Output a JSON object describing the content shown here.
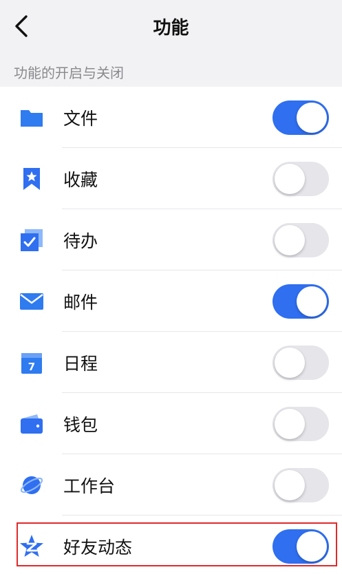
{
  "header": {
    "title": "功能"
  },
  "section": {
    "title": "功能的开启与关闭"
  },
  "colors": {
    "accent": "#2f6ff0",
    "toggle_off": "#e5e5ea",
    "highlight": "#e0292b"
  },
  "features": [
    {
      "label": "文件",
      "icon": "folder-icon",
      "enabled": true
    },
    {
      "label": "收藏",
      "icon": "bookmark-star-icon",
      "enabled": false
    },
    {
      "label": "待办",
      "icon": "checkbox-todo-icon",
      "enabled": false
    },
    {
      "label": "邮件",
      "icon": "mail-icon",
      "enabled": true
    },
    {
      "label": "日程",
      "icon": "calendar-icon",
      "enabled": false
    },
    {
      "label": "钱包",
      "icon": "wallet-icon",
      "enabled": false
    },
    {
      "label": "工作台",
      "icon": "planet-icon",
      "enabled": false
    },
    {
      "label": "好友动态",
      "icon": "qzone-star-icon",
      "enabled": true,
      "highlighted": true
    }
  ]
}
